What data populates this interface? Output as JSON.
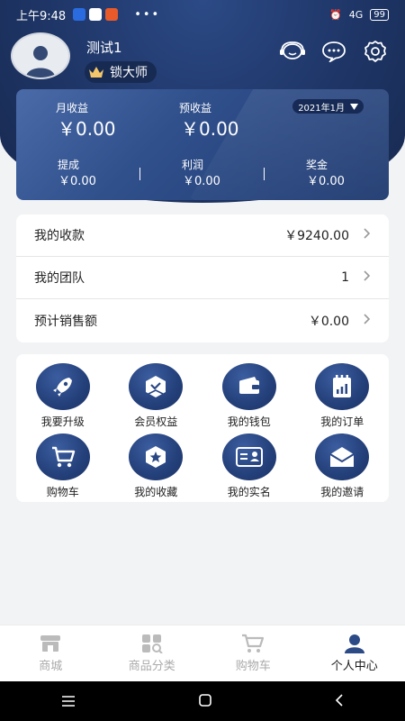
{
  "status_bar": {
    "time": "上午9:48",
    "dots": "•••",
    "signal_text": "4G",
    "battery": "99"
  },
  "profile": {
    "username": "测试1",
    "badge_label": "锁大师"
  },
  "earnings": {
    "month_label": "月收益",
    "month_value": "￥0.00",
    "forecast_label": "预收益",
    "forecast_value": "￥0.00",
    "month_selector": "2021年1月",
    "withdraw_label": "提成",
    "withdraw_value": "￥0.00",
    "profit_label": "利润",
    "profit_value": "￥0.00",
    "bonus_label": "奖金",
    "bonus_value": "￥0.00"
  },
  "summary_list": [
    {
      "label": "我的收款",
      "value": "￥9240.00"
    },
    {
      "label": "我的团队",
      "value": "1"
    },
    {
      "label": "预计销售额",
      "value": "￥0.00"
    }
  ],
  "grid": [
    {
      "label": "我要升级",
      "icon": "rocket-icon"
    },
    {
      "label": "会员权益",
      "icon": "membership-icon"
    },
    {
      "label": "我的钱包",
      "icon": "wallet-icon"
    },
    {
      "label": "我的订单",
      "icon": "orders-icon"
    },
    {
      "label": "购物车",
      "icon": "cart-icon"
    },
    {
      "label": "我的收藏",
      "icon": "star-icon"
    },
    {
      "label": "我的实名",
      "icon": "id-card-icon"
    },
    {
      "label": "我的邀请",
      "icon": "envelope-icon"
    }
  ],
  "tabs": [
    {
      "label": "商城",
      "icon": "store-icon"
    },
    {
      "label": "商品分类",
      "icon": "category-icon"
    },
    {
      "label": "购物车",
      "icon": "cart-icon"
    },
    {
      "label": "个人中心",
      "icon": "user-icon",
      "active": true
    }
  ],
  "colors": {
    "brand_dark": "#1e3566",
    "card_blue": "#30508c",
    "tab_active": "#1a1a1a",
    "tab_inactive": "#aaaaaa"
  }
}
